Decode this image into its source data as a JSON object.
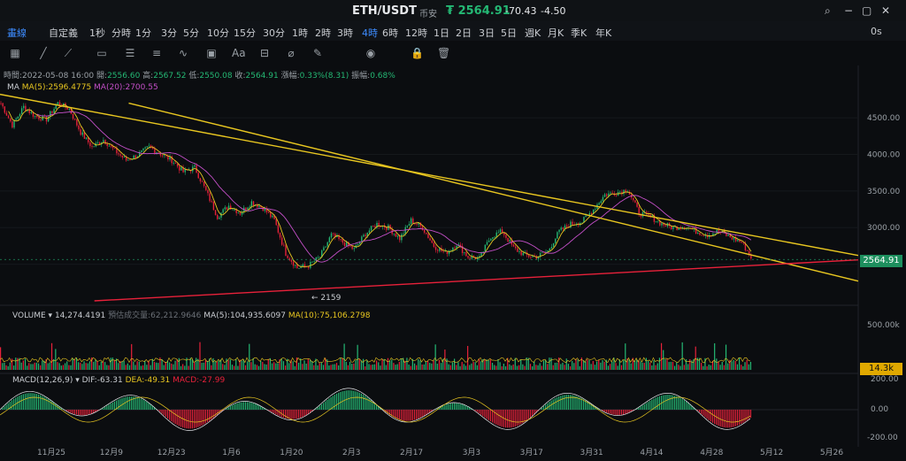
{
  "header": {
    "pair": "ETH/USDT",
    "exchange": "币安",
    "price": "₮ 2564.91",
    "change": "-70.43",
    "change_pct": "-4.50",
    "icons": [
      "search-icon",
      "minimize-icon",
      "maximize-icon",
      "close-icon"
    ]
  },
  "toolbar": {
    "draw_label": "畫線",
    "custom_label": "自定義",
    "timeframes": [
      "1秒",
      "分時",
      "1分",
      "3分",
      "5分",
      "10分",
      "15分",
      "30分",
      "1時",
      "2時",
      "3時",
      "4時",
      "6時",
      "12時",
      "1日",
      "2日",
      "3日",
      "5日",
      "週K",
      "月K",
      "季K",
      "年K"
    ],
    "active_timeframe": "4時",
    "zero_label": "0s",
    "tools": [
      "grid-icon",
      "line-icon",
      "ray-icon",
      "channel-icon",
      "rect-icon",
      "fib-icon",
      "wave-icon",
      "shape-icon",
      "text-icon",
      "measure-icon",
      "magnet-icon",
      "ruler-icon",
      "eye-icon",
      "lock-icon",
      "delete-icon"
    ]
  },
  "ohlc": {
    "time_label": "時間:",
    "time": "2022-05-08 16:00",
    "open_label": "開:",
    "open": "2556.60",
    "high_label": "高:",
    "high": "2567.52",
    "low_label": "低:",
    "low": "2550.08",
    "close_label": "收:",
    "close": "2564.91",
    "chg_label": "漲幅:",
    "chg": "0.33%(8.31)",
    "amp_label": "振幅:",
    "amp": "0.68%"
  },
  "ma": {
    "label": "MA",
    "ma5": "MA(5):2596.4775",
    "ma20": "MA(20):2700.55"
  },
  "volume": {
    "label": "VOLUME",
    "value": "14,274.4191",
    "est_label": "預估成交量:",
    "est": "62,212.9646",
    "ma5": "MA(5):104,935.6097",
    "ma10": "MA(10):75,106.2798",
    "axis_top": "500.00k",
    "tag": "14.3k"
  },
  "macd": {
    "label": "MACD(12,26,9)",
    "dif": "DIF:-63.31",
    "dea": "DEA:-49.31",
    "macd": "MACD:-27.99",
    "axis_top": "200.00",
    "axis_mid": "0.00",
    "axis_bot": "-200.00"
  },
  "chart_data": {
    "type": "candlestick",
    "title": "ETH/USDT",
    "y_axis_ticks": [
      4500,
      4000,
      3500,
      3000,
      2500
    ],
    "ylim": [
      2000,
      4900
    ],
    "x_axis_ticks": [
      "11月25",
      "12月9",
      "12月23",
      "1月6",
      "1月20",
      "2月3",
      "2月17",
      "3月3",
      "3月17",
      "3月31",
      "4月14",
      "4月28",
      "5月12",
      "5月26"
    ],
    "last_price": 2564.91,
    "annotations": [
      {
        "text": "← 2159",
        "value": 2159
      }
    ],
    "close_path": [
      4700,
      4400,
      4650,
      4520,
      4480,
      4700,
      4620,
      4300,
      4100,
      4200,
      4050,
      3920,
      3990,
      4100,
      4010,
      3920,
      3760,
      3820,
      3500,
      3150,
      3300,
      3200,
      3350,
      3270,
      3100,
      2650,
      2450,
      2480,
      2600,
      2900,
      2800,
      2700,
      2920,
      3050,
      3000,
      2850,
      3100,
      3000,
      2750,
      2650,
      2780,
      2600,
      2580,
      2880,
      2950,
      2720,
      2620,
      2600,
      2680,
      2950,
      3050,
      3080,
      3250,
      3450,
      3480,
      3520,
      3200,
      3150,
      3050,
      3000,
      3020,
      2950,
      2900,
      2950,
      2870,
      2800,
      2560
    ],
    "trendlines": [
      {
        "color": "#e8c620",
        "points": [
          [
            0,
            4820
          ],
          [
            100,
            2620
          ]
        ]
      },
      {
        "color": "#e8c620",
        "points": [
          [
            15,
            4700
          ],
          [
            100,
            2270
          ]
        ]
      },
      {
        "color": "#e8213a",
        "points": [
          [
            11,
            2000
          ],
          [
            100,
            2560
          ]
        ]
      }
    ],
    "series": [
      {
        "name": "MA(5)",
        "color": "#e8c620"
      },
      {
        "name": "MA(20)",
        "color": "#c44fc8"
      }
    ]
  }
}
